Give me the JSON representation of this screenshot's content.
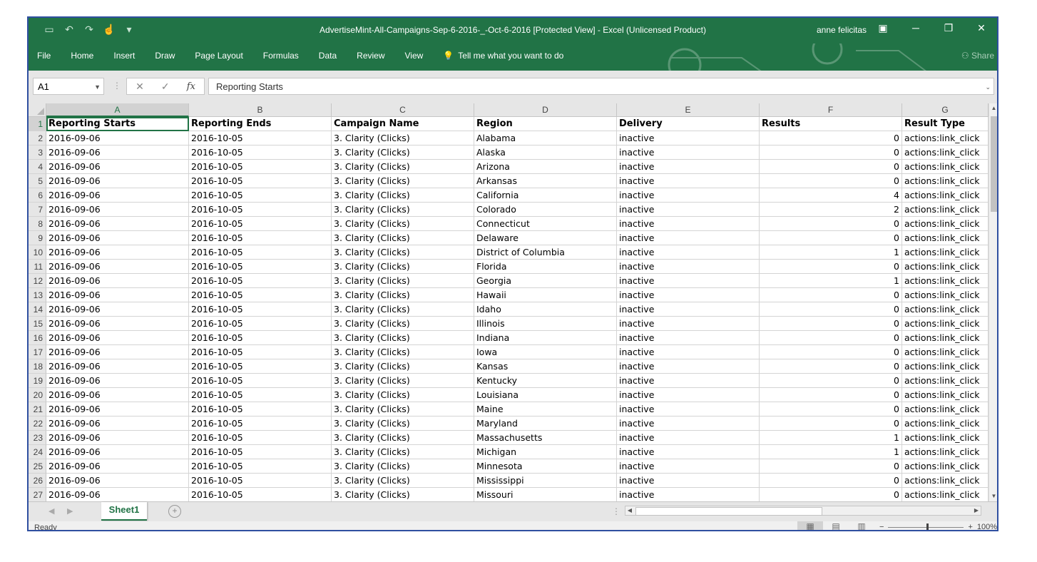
{
  "window": {
    "title": "AdvertiseMint-All-Campaigns-Sep-6-2016-_-Oct-6-2016  [Protected View] - Excel (Unlicensed Product)",
    "user": "anne felicitas",
    "brand_color": "#217346"
  },
  "ribbon": {
    "tabs": [
      "File",
      "Home",
      "Insert",
      "Draw",
      "Page Layout",
      "Formulas",
      "Data",
      "Review",
      "View"
    ],
    "tell_me": "Tell me what you want to do",
    "share": "Share"
  },
  "formula_bar": {
    "name_box": "A1",
    "fx_label": "fx",
    "content": "Reporting Starts"
  },
  "sheet": {
    "columns": [
      "A",
      "B",
      "C",
      "D",
      "E",
      "F",
      "G"
    ],
    "header": [
      "Reporting Starts",
      "Reporting Ends",
      "Campaign Name",
      "Region",
      "Delivery",
      "Results",
      "Result Type"
    ],
    "rows": [
      [
        "2016-09-06",
        "2016-10-05",
        "3. Clarity (Clicks)",
        "Alabama",
        "inactive",
        "0",
        "actions:link_click"
      ],
      [
        "2016-09-06",
        "2016-10-05",
        "3. Clarity (Clicks)",
        "Alaska",
        "inactive",
        "0",
        "actions:link_click"
      ],
      [
        "2016-09-06",
        "2016-10-05",
        "3. Clarity (Clicks)",
        "Arizona",
        "inactive",
        "0",
        "actions:link_click"
      ],
      [
        "2016-09-06",
        "2016-10-05",
        "3. Clarity (Clicks)",
        "Arkansas",
        "inactive",
        "0",
        "actions:link_click"
      ],
      [
        "2016-09-06",
        "2016-10-05",
        "3. Clarity (Clicks)",
        "California",
        "inactive",
        "4",
        "actions:link_click"
      ],
      [
        "2016-09-06",
        "2016-10-05",
        "3. Clarity (Clicks)",
        "Colorado",
        "inactive",
        "2",
        "actions:link_click"
      ],
      [
        "2016-09-06",
        "2016-10-05",
        "3. Clarity (Clicks)",
        "Connecticut",
        "inactive",
        "0",
        "actions:link_click"
      ],
      [
        "2016-09-06",
        "2016-10-05",
        "3. Clarity (Clicks)",
        "Delaware",
        "inactive",
        "0",
        "actions:link_click"
      ],
      [
        "2016-09-06",
        "2016-10-05",
        "3. Clarity (Clicks)",
        "District of Columbia",
        "inactive",
        "1",
        "actions:link_click"
      ],
      [
        "2016-09-06",
        "2016-10-05",
        "3. Clarity (Clicks)",
        "Florida",
        "inactive",
        "0",
        "actions:link_click"
      ],
      [
        "2016-09-06",
        "2016-10-05",
        "3. Clarity (Clicks)",
        "Georgia",
        "inactive",
        "1",
        "actions:link_click"
      ],
      [
        "2016-09-06",
        "2016-10-05",
        "3. Clarity (Clicks)",
        "Hawaii",
        "inactive",
        "0",
        "actions:link_click"
      ],
      [
        "2016-09-06",
        "2016-10-05",
        "3. Clarity (Clicks)",
        "Idaho",
        "inactive",
        "0",
        "actions:link_click"
      ],
      [
        "2016-09-06",
        "2016-10-05",
        "3. Clarity (Clicks)",
        "Illinois",
        "inactive",
        "0",
        "actions:link_click"
      ],
      [
        "2016-09-06",
        "2016-10-05",
        "3. Clarity (Clicks)",
        "Indiana",
        "inactive",
        "0",
        "actions:link_click"
      ],
      [
        "2016-09-06",
        "2016-10-05",
        "3. Clarity (Clicks)",
        "Iowa",
        "inactive",
        "0",
        "actions:link_click"
      ],
      [
        "2016-09-06",
        "2016-10-05",
        "3. Clarity (Clicks)",
        "Kansas",
        "inactive",
        "0",
        "actions:link_click"
      ],
      [
        "2016-09-06",
        "2016-10-05",
        "3. Clarity (Clicks)",
        "Kentucky",
        "inactive",
        "0",
        "actions:link_click"
      ],
      [
        "2016-09-06",
        "2016-10-05",
        "3. Clarity (Clicks)",
        "Louisiana",
        "inactive",
        "0",
        "actions:link_click"
      ],
      [
        "2016-09-06",
        "2016-10-05",
        "3. Clarity (Clicks)",
        "Maine",
        "inactive",
        "0",
        "actions:link_click"
      ],
      [
        "2016-09-06",
        "2016-10-05",
        "3. Clarity (Clicks)",
        "Maryland",
        "inactive",
        "0",
        "actions:link_click"
      ],
      [
        "2016-09-06",
        "2016-10-05",
        "3. Clarity (Clicks)",
        "Massachusetts",
        "inactive",
        "1",
        "actions:link_click"
      ],
      [
        "2016-09-06",
        "2016-10-05",
        "3. Clarity (Clicks)",
        "Michigan",
        "inactive",
        "1",
        "actions:link_click"
      ],
      [
        "2016-09-06",
        "2016-10-05",
        "3. Clarity (Clicks)",
        "Minnesota",
        "inactive",
        "0",
        "actions:link_click"
      ],
      [
        "2016-09-06",
        "2016-10-05",
        "3. Clarity (Clicks)",
        "Mississippi",
        "inactive",
        "0",
        "actions:link_click"
      ],
      [
        "2016-09-06",
        "2016-10-05",
        "3. Clarity (Clicks)",
        "Missouri",
        "inactive",
        "0",
        "actions:link_click"
      ]
    ],
    "tab_name": "Sheet1"
  },
  "status": {
    "text": "Ready",
    "zoom": "100%"
  }
}
